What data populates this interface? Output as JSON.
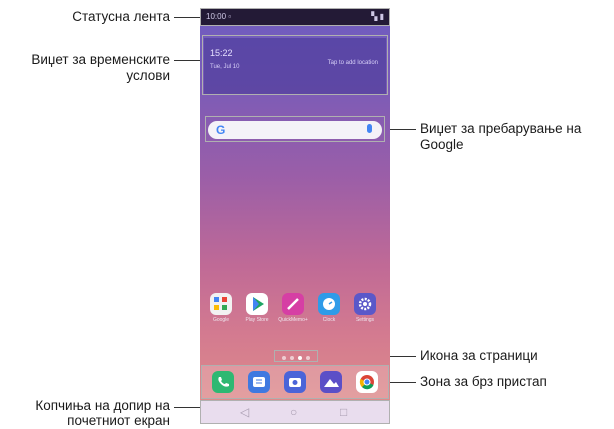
{
  "annotations": {
    "status_bar": "Статусна лента",
    "weather_widget_line1": "Виџет за временските",
    "weather_widget_line2": "услови",
    "google_search_line1": "Виџет за пребарување на",
    "google_search_line2": "Google",
    "page_icon": "Икона за страници",
    "quick_access": "Зона за брз пристап",
    "home_touch_line1": "Копчиња на допир на",
    "home_touch_line2": "почетниот екран"
  },
  "screen": {
    "status_time": "10:00 ▫",
    "status_icons": "▚ ▮",
    "weather_temp": "15:22",
    "weather_date": "Tue, Jul 10",
    "weather_hint": "Tap to add location",
    "google_logo": "G"
  },
  "apps": [
    {
      "name": "Google",
      "color": "#f2f2f2"
    },
    {
      "name": "Play Store",
      "color": "#ffffff"
    },
    {
      "name": "QuickMemo+",
      "color": "#d63fa4"
    },
    {
      "name": "Clock",
      "color": "#2f9be8"
    },
    {
      "name": "Settings",
      "color": "#5a58c9"
    }
  ],
  "dock_apps": [
    {
      "name": "Phone",
      "color": "#2eb872"
    },
    {
      "name": "Messaging",
      "color": "#3f79e0"
    },
    {
      "name": "Camera",
      "color": "#4a64d8"
    },
    {
      "name": "Gallery",
      "color": "#5b4fc7"
    },
    {
      "name": "Chrome",
      "color": "#ffffff"
    }
  ],
  "nav": {
    "back": "◁",
    "home": "○",
    "recent": "□"
  }
}
